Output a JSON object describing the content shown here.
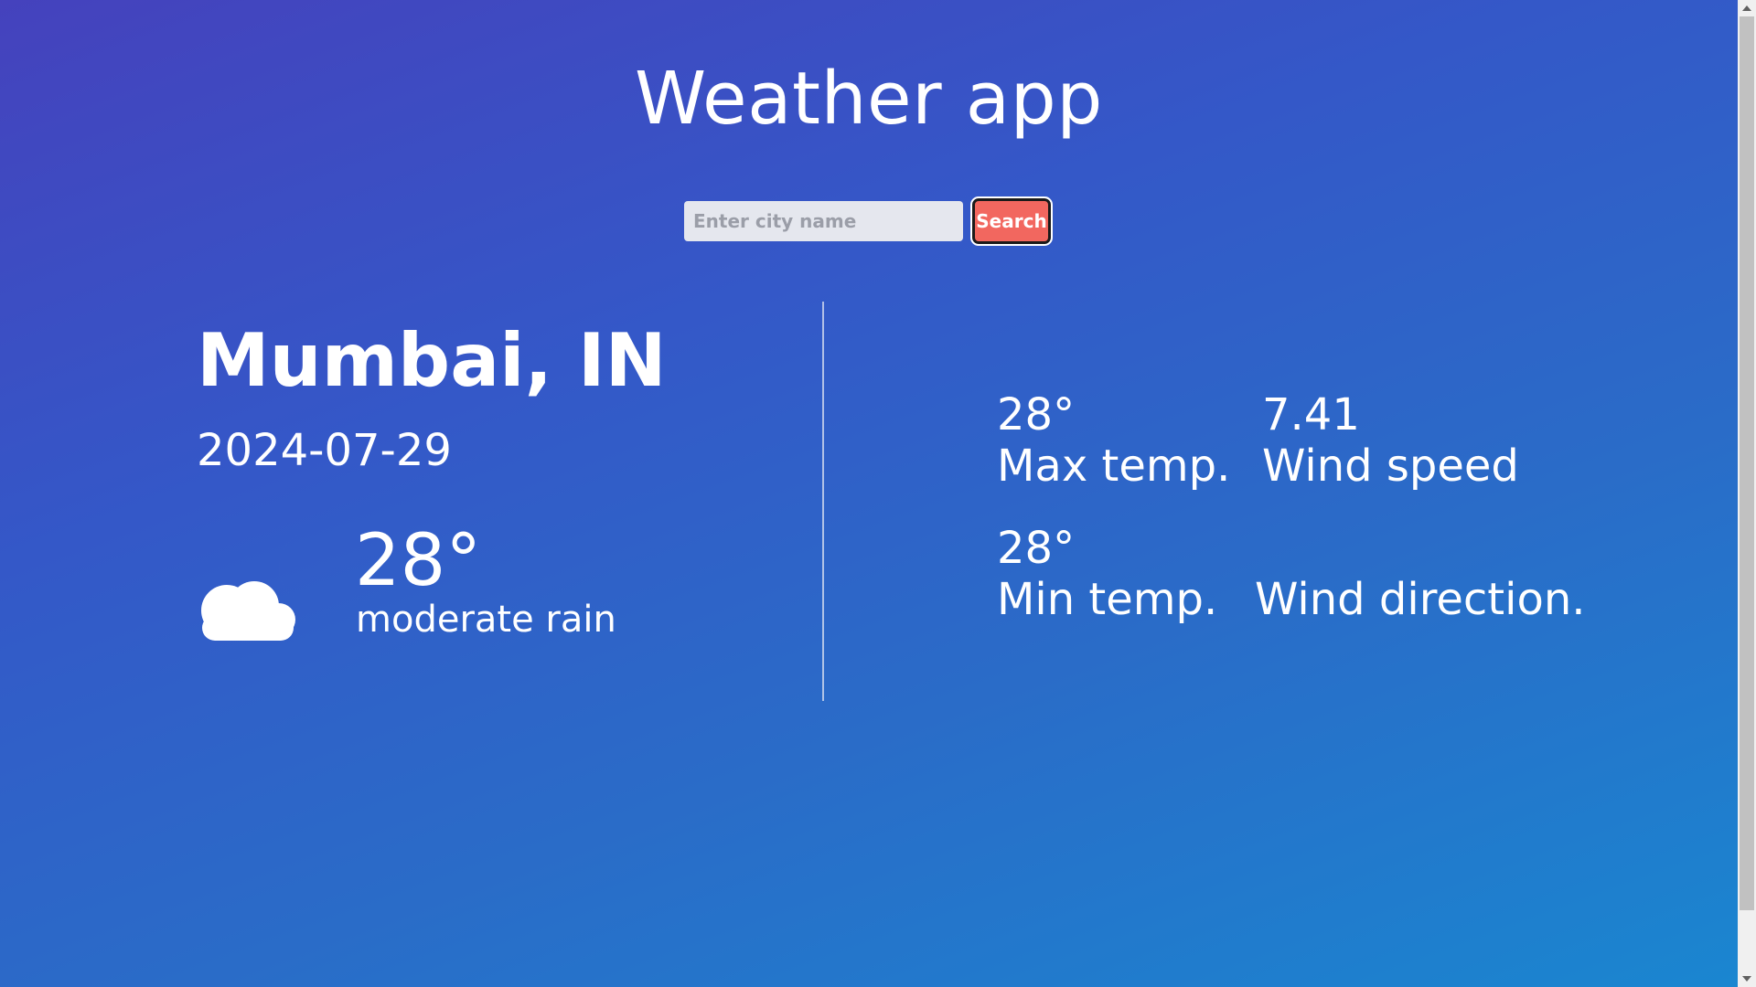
{
  "app": {
    "title": "Weather app"
  },
  "search": {
    "placeholder": "Enter city name",
    "value": "",
    "button_label": "Search"
  },
  "location": {
    "city": "Mumbai, IN",
    "date": "2024-07-29"
  },
  "current": {
    "icon": "cloud-moon-icon",
    "temperature": "28°",
    "description": "moderate rain"
  },
  "stats": {
    "max_temp": {
      "value": "28°",
      "label": "Max temp."
    },
    "wind_speed": {
      "value": "7.41",
      "label": "Wind speed"
    },
    "min_temp": {
      "value": "28°",
      "label": "Min temp."
    },
    "wind_direction": {
      "value": "",
      "label": "Wind direction."
    }
  },
  "colors": {
    "background_gradient": [
      "#4542bd",
      "#1a86d0"
    ],
    "search_button": "#f2675f",
    "text": "#ffffff"
  }
}
